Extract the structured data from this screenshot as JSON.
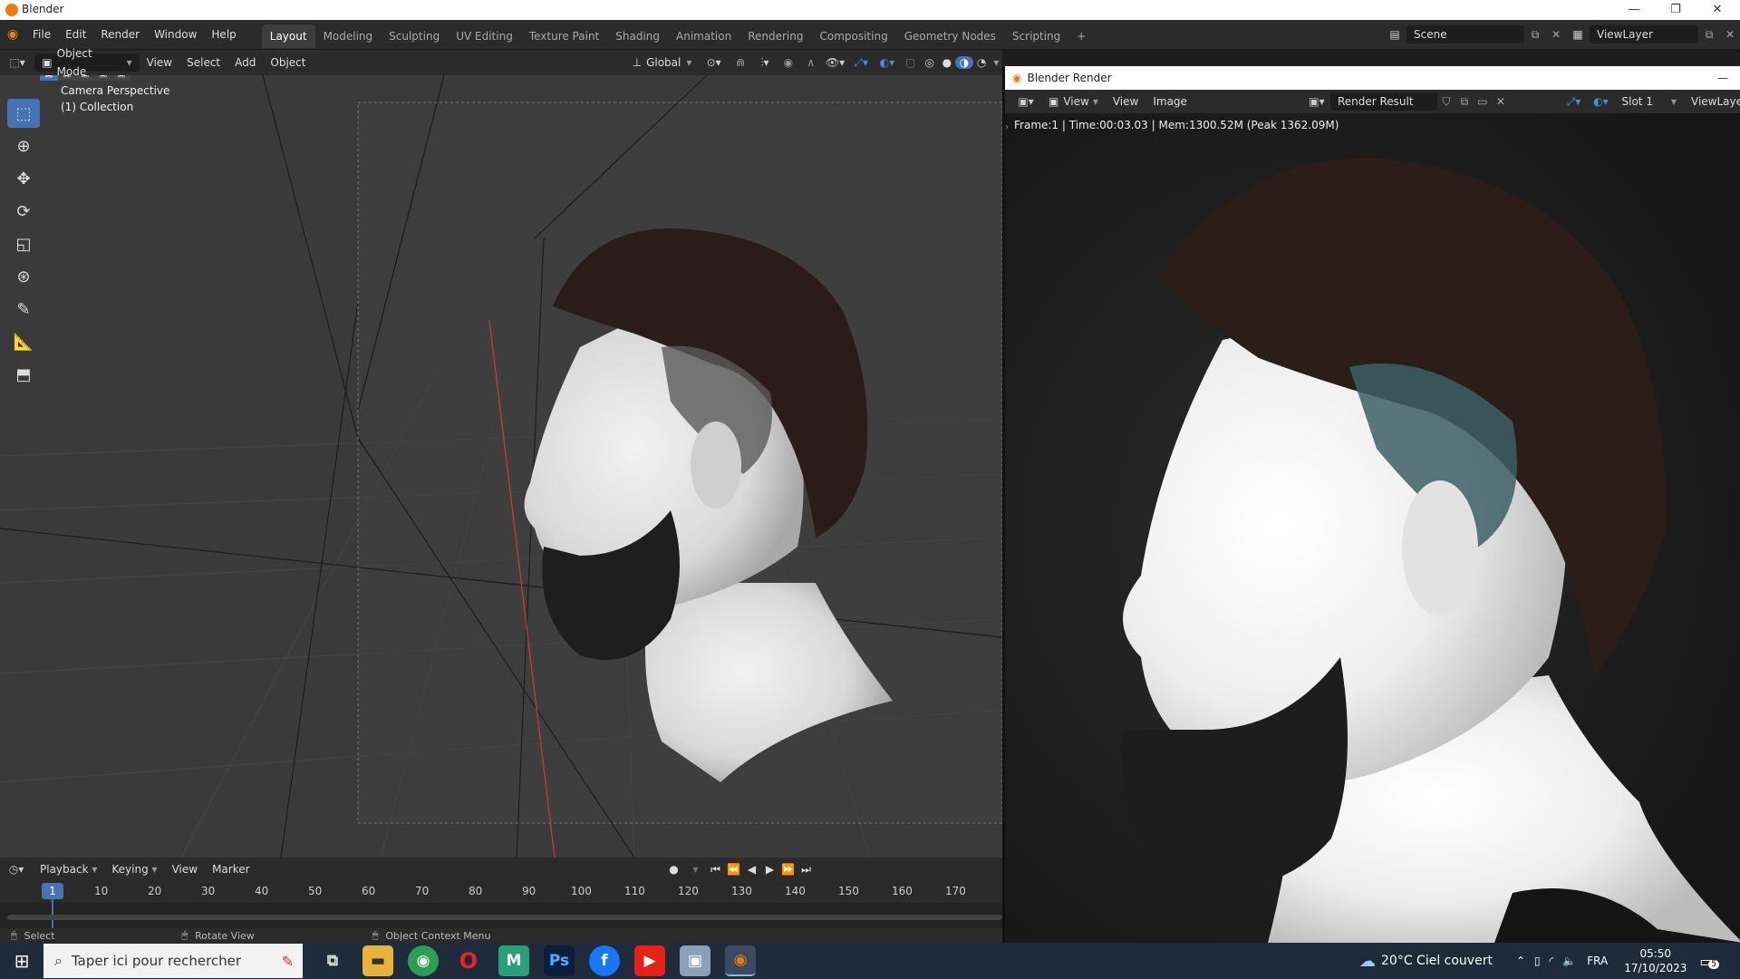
{
  "window": {
    "title": "Blender"
  },
  "menu": {
    "items": [
      "File",
      "Edit",
      "Render",
      "Window",
      "Help"
    ],
    "workspaces": [
      "Layout",
      "Modeling",
      "Sculpting",
      "UV Editing",
      "Texture Paint",
      "Shading",
      "Animation",
      "Rendering",
      "Compositing",
      "Geometry Nodes",
      "Scripting"
    ],
    "active_workspace": "Layout",
    "add_tab": "+",
    "scene": "Scene",
    "view_layer": "ViewLayer"
  },
  "viewport_header": {
    "mode": "Object Mode",
    "items": [
      "View",
      "Select",
      "Add",
      "Object"
    ],
    "transform_orientation": "Global"
  },
  "viewport": {
    "camera_label": "Camera Perspective",
    "collection_label": "(1) Collection"
  },
  "render_window": {
    "title": "Blender Render",
    "view_menu": "View",
    "menus": [
      "View",
      "Image"
    ],
    "image_name": "Render Result",
    "slot": "Slot 1",
    "view_layer": "ViewLaye",
    "info": "Frame:1 | Time:00:03.03 | Mem:1300.52M (Peak 1362.09M)"
  },
  "timeline": {
    "menus": [
      "Playback",
      "Keying",
      "View",
      "Marker"
    ],
    "current_frame": "1",
    "ticks": [
      "10",
      "20",
      "30",
      "40",
      "50",
      "60",
      "70",
      "80",
      "90",
      "100",
      "110",
      "120",
      "130",
      "140",
      "150",
      "160",
      "170"
    ]
  },
  "statusbar": {
    "select": "Select",
    "rotate": "Rotate View",
    "context": "Object Context Menu"
  },
  "taskbar": {
    "search_placeholder": "Taper ici pour rechercher",
    "weather": "20°C  Ciel couvert",
    "language": "FRA",
    "time": "05:50",
    "date": "17/10/2023",
    "notifications": "5"
  },
  "colors": {
    "accent": "#4772b3",
    "blender_orange": "#e87d0d",
    "axis_red": "#c73a3a"
  }
}
